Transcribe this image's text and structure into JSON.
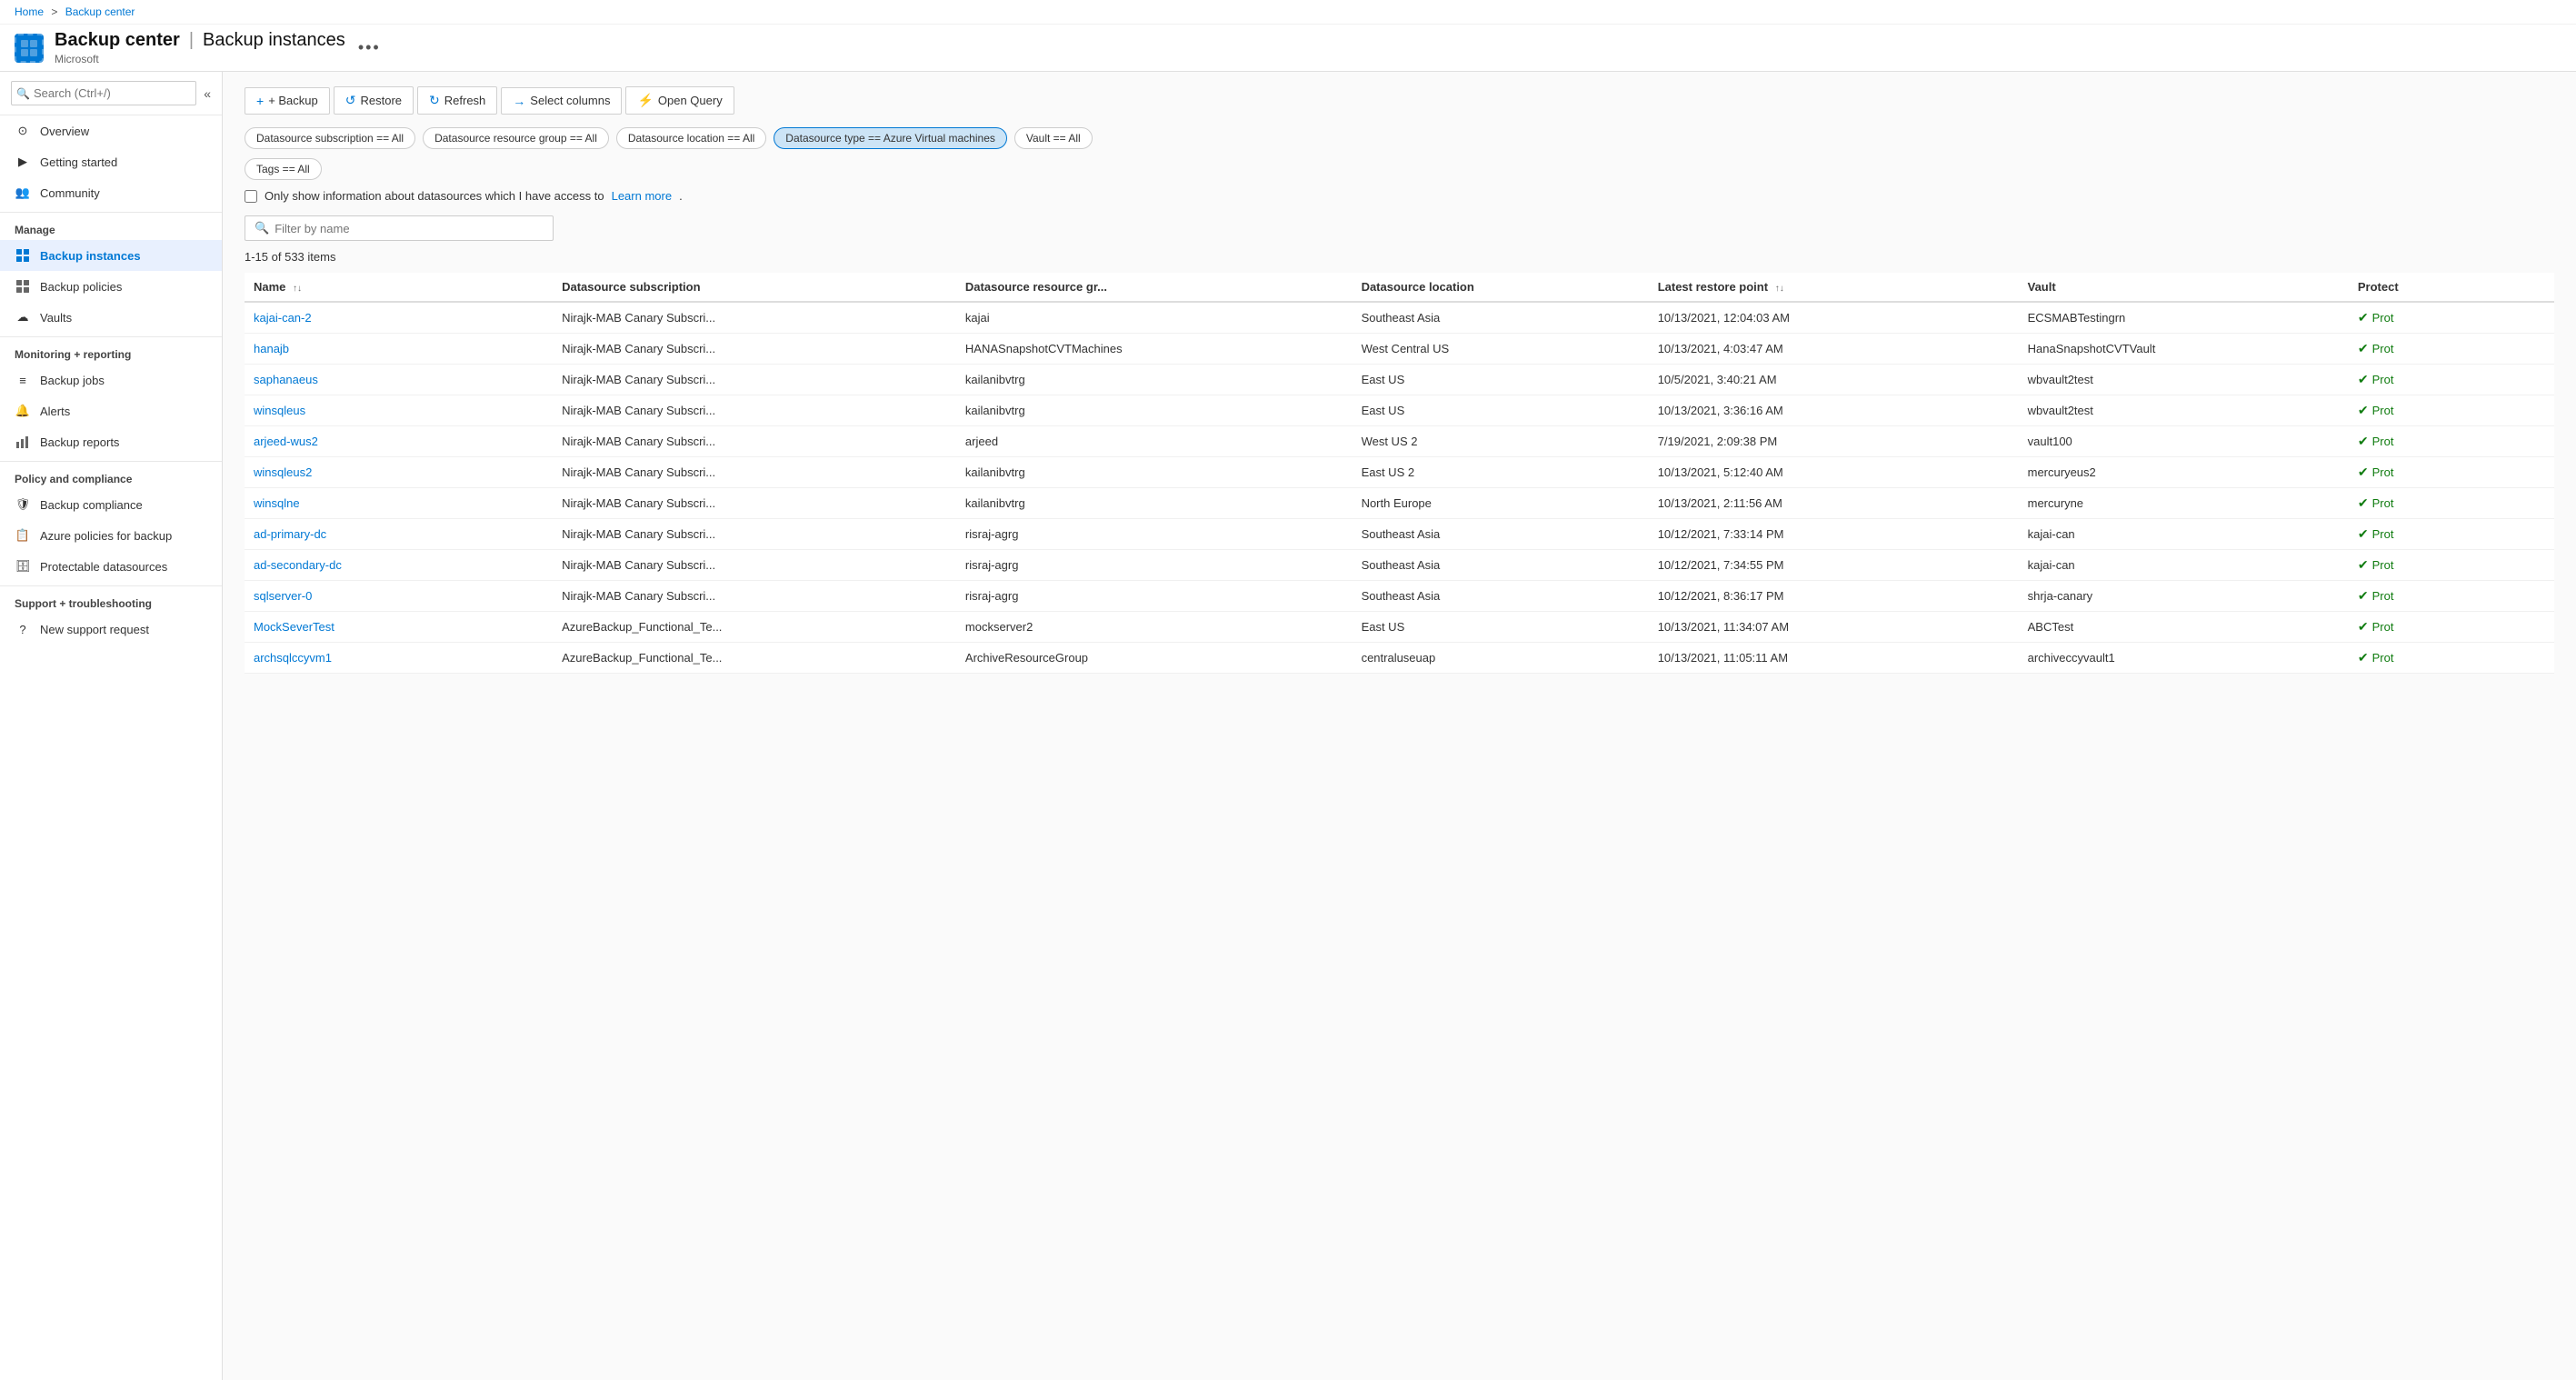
{
  "breadcrumb": {
    "home": "Home",
    "separator": ">",
    "current": "Backup center"
  },
  "header": {
    "app_name": "Backup center",
    "separator": "|",
    "page_name": "Backup instances",
    "subtitle": "Microsoft",
    "more_icon": "•••"
  },
  "sidebar": {
    "search_placeholder": "Search (Ctrl+/)",
    "collapse_icon": "«",
    "nav_items": [
      {
        "id": "overview",
        "label": "Overview",
        "icon": "⊙"
      },
      {
        "id": "getting-started",
        "label": "Getting started",
        "icon": "▶"
      },
      {
        "id": "community",
        "label": "Community",
        "icon": "👥"
      }
    ],
    "manage_label": "Manage",
    "manage_items": [
      {
        "id": "backup-instances",
        "label": "Backup instances",
        "icon": "▦",
        "active": true
      },
      {
        "id": "backup-policies",
        "label": "Backup policies",
        "icon": "⊞"
      },
      {
        "id": "vaults",
        "label": "Vaults",
        "icon": "☁"
      }
    ],
    "monitoring_label": "Monitoring + reporting",
    "monitoring_items": [
      {
        "id": "backup-jobs",
        "label": "Backup jobs",
        "icon": "≡"
      },
      {
        "id": "alerts",
        "label": "Alerts",
        "icon": "🔔"
      },
      {
        "id": "backup-reports",
        "label": "Backup reports",
        "icon": "📊"
      }
    ],
    "policy_label": "Policy and compliance",
    "policy_items": [
      {
        "id": "backup-compliance",
        "label": "Backup compliance",
        "icon": "🛡"
      },
      {
        "id": "azure-policies",
        "label": "Azure policies for backup",
        "icon": "📋"
      },
      {
        "id": "protectable-datasources",
        "label": "Protectable datasources",
        "icon": "🗄"
      }
    ],
    "support_label": "Support + troubleshooting",
    "support_items": [
      {
        "id": "new-support-request",
        "label": "New support request",
        "icon": "?"
      }
    ]
  },
  "toolbar": {
    "backup_label": "+ Backup",
    "restore_label": "Restore",
    "refresh_label": "Refresh",
    "select_columns_label": "Select columns",
    "open_query_label": "Open Query"
  },
  "filters": [
    {
      "id": "subscription",
      "label": "Datasource subscription == All",
      "active": false
    },
    {
      "id": "resource-group",
      "label": "Datasource resource group == All",
      "active": false
    },
    {
      "id": "location",
      "label": "Datasource location == All",
      "active": false
    },
    {
      "id": "type",
      "label": "Datasource type == Azure Virtual machines",
      "active": true
    },
    {
      "id": "vault",
      "label": "Vault == All",
      "active": false
    },
    {
      "id": "tags",
      "label": "Tags == All",
      "active": false
    }
  ],
  "checkbox": {
    "label": "Only show information about datasources which I have access to",
    "learn_more": "Learn more"
  },
  "search": {
    "placeholder": "Filter by name"
  },
  "items_count": "1-15 of 533 items",
  "table": {
    "columns": [
      {
        "id": "name",
        "label": "Name",
        "sortable": true
      },
      {
        "id": "subscription",
        "label": "Datasource subscription",
        "sortable": false
      },
      {
        "id": "resource-group",
        "label": "Datasource resource gr...",
        "sortable": false
      },
      {
        "id": "location",
        "label": "Datasource location",
        "sortable": false
      },
      {
        "id": "restore-point",
        "label": "Latest restore point",
        "sortable": true
      },
      {
        "id": "vault",
        "label": "Vault",
        "sortable": false
      },
      {
        "id": "protection",
        "label": "Protect",
        "sortable": false
      }
    ],
    "rows": [
      {
        "name": "kajai-can-2",
        "subscription": "Nirajk-MAB Canary Subscri...",
        "resource_group": "kajai",
        "location": "Southeast Asia",
        "restore_point": "10/13/2021, 12:04:03 AM",
        "vault": "ECSMABTestingrn",
        "protection": "Prot"
      },
      {
        "name": "hanajb",
        "subscription": "Nirajk-MAB Canary Subscri...",
        "resource_group": "HANASnapshotCVTMachines",
        "location": "West Central US",
        "restore_point": "10/13/2021, 4:03:47 AM",
        "vault": "HanaSnapshotCVTVault",
        "protection": "Prot"
      },
      {
        "name": "saphanaeus",
        "subscription": "Nirajk-MAB Canary Subscri...",
        "resource_group": "kailanibvtrg",
        "location": "East US",
        "restore_point": "10/5/2021, 3:40:21 AM",
        "vault": "wbvault2test",
        "protection": "Prot"
      },
      {
        "name": "winsqleus",
        "subscription": "Nirajk-MAB Canary Subscri...",
        "resource_group": "kailanibvtrg",
        "location": "East US",
        "restore_point": "10/13/2021, 3:36:16 AM",
        "vault": "wbvault2test",
        "protection": "Prot"
      },
      {
        "name": "arjeed-wus2",
        "subscription": "Nirajk-MAB Canary Subscri...",
        "resource_group": "arjeed",
        "location": "West US 2",
        "restore_point": "7/19/2021, 2:09:38 PM",
        "vault": "vault100",
        "protection": "Prot"
      },
      {
        "name": "winsqleus2",
        "subscription": "Nirajk-MAB Canary Subscri...",
        "resource_group": "kailanibvtrg",
        "location": "East US 2",
        "restore_point": "10/13/2021, 5:12:40 AM",
        "vault": "mercuryeus2",
        "protection": "Prot"
      },
      {
        "name": "winsqlne",
        "subscription": "Nirajk-MAB Canary Subscri...",
        "resource_group": "kailanibvtrg",
        "location": "North Europe",
        "restore_point": "10/13/2021, 2:11:56 AM",
        "vault": "mercuryne",
        "protection": "Prot"
      },
      {
        "name": "ad-primary-dc",
        "subscription": "Nirajk-MAB Canary Subscri...",
        "resource_group": "risraj-agrg",
        "location": "Southeast Asia",
        "restore_point": "10/12/2021, 7:33:14 PM",
        "vault": "kajai-can",
        "protection": "Prot"
      },
      {
        "name": "ad-secondary-dc",
        "subscription": "Nirajk-MAB Canary Subscri...",
        "resource_group": "risraj-agrg",
        "location": "Southeast Asia",
        "restore_point": "10/12/2021, 7:34:55 PM",
        "vault": "kajai-can",
        "protection": "Prot"
      },
      {
        "name": "sqlserver-0",
        "subscription": "Nirajk-MAB Canary Subscri...",
        "resource_group": "risraj-agrg",
        "location": "Southeast Asia",
        "restore_point": "10/12/2021, 8:36:17 PM",
        "vault": "shrja-canary",
        "protection": "Prot"
      },
      {
        "name": "MockSeverTest",
        "subscription": "AzureBackup_Functional_Te...",
        "resource_group": "mockserver2",
        "location": "East US",
        "restore_point": "10/13/2021, 11:34:07 AM",
        "vault": "ABCTest",
        "protection": "Prot"
      },
      {
        "name": "archsqlccyvm1",
        "subscription": "AzureBackup_Functional_Te...",
        "resource_group": "ArchiveResourceGroup",
        "location": "centraluseuap",
        "restore_point": "10/13/2021, 11:05:11 AM",
        "vault": "archiveccyvault1",
        "protection": "Prot"
      }
    ]
  }
}
